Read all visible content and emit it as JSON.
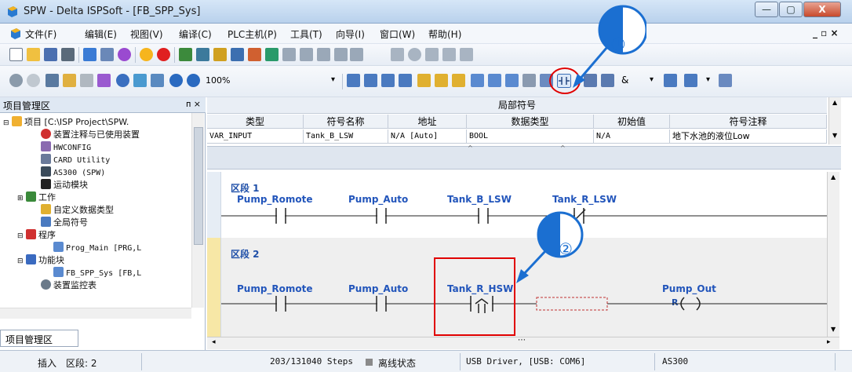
{
  "window": {
    "title": "SPW - Delta ISPSoft - [FB_SPP_Sys]",
    "min": "—",
    "max": "▢",
    "close": "X"
  },
  "menu": [
    "文件(F)",
    "编辑(E)",
    "视图(V)",
    "编译(C)",
    "PLC主机(P)",
    "工具(T)",
    "向导(I)",
    "窗口(W)",
    "帮助(H)"
  ],
  "menu_right": "_ ▫ ×",
  "toolbar2": {
    "zoom": "100%"
  },
  "toolbar2_extra": {
    "amp": "&"
  },
  "left_panel": {
    "title": "项目管理区",
    "pin": "ᴨ ×",
    "items": [
      {
        "text": "项目 [C:\\ISP Project\\SPW."
      },
      {
        "text": "装置注释与已使用装置"
      },
      {
        "text": "HWCONFIG"
      },
      {
        "text": "CARD Utility"
      },
      {
        "text": "AS300  (SPW)"
      },
      {
        "text": "运动模块"
      },
      {
        "text": "工作"
      },
      {
        "text": "自定义数据类型"
      },
      {
        "text": "全局符号"
      },
      {
        "text": "程序"
      },
      {
        "text": "Prog_Main [PRG,L"
      },
      {
        "text": "功能块"
      },
      {
        "text": "FB_SPP_Sys [FB,L"
      },
      {
        "text": "装置监控表"
      }
    ],
    "tab": "项目管理区"
  },
  "symbol_table": {
    "title": "局部符号",
    "headers": [
      "类型",
      "符号名称",
      "地址",
      "数据类型",
      "初始值",
      "符号注释"
    ],
    "row": [
      "VAR_INPUT",
      "Tank_B_LSW",
      "N/A [Auto]",
      "BOOL",
      "N/A",
      "地下水池的液位Low"
    ]
  },
  "ladder": {
    "segment1": {
      "label": "区段 1",
      "contacts": [
        "Pump_Romote",
        "Pump_Auto",
        "Tank_B_LSW",
        "Tank_R_LSW"
      ]
    },
    "segment2": {
      "label": "区段 2",
      "contacts": [
        "Pump_Romote",
        "Pump_Auto",
        "Tank_R_HSW"
      ],
      "coil": "Pump_Out",
      "coil_symbol": "R"
    }
  },
  "callouts": [
    {
      "number": "①"
    },
    {
      "number": "②"
    }
  ],
  "status": {
    "mode": "插入",
    "segment": "区段: 2",
    "steps": "203/131040 Steps",
    "state": "离线状态",
    "driver": "USB Driver, [USB: COM6]",
    "model": "AS300"
  },
  "colors": {
    "accent_red": "#e00000",
    "callout_blue": "#1b6fd1",
    "segment_label": "#1f4fa8"
  }
}
